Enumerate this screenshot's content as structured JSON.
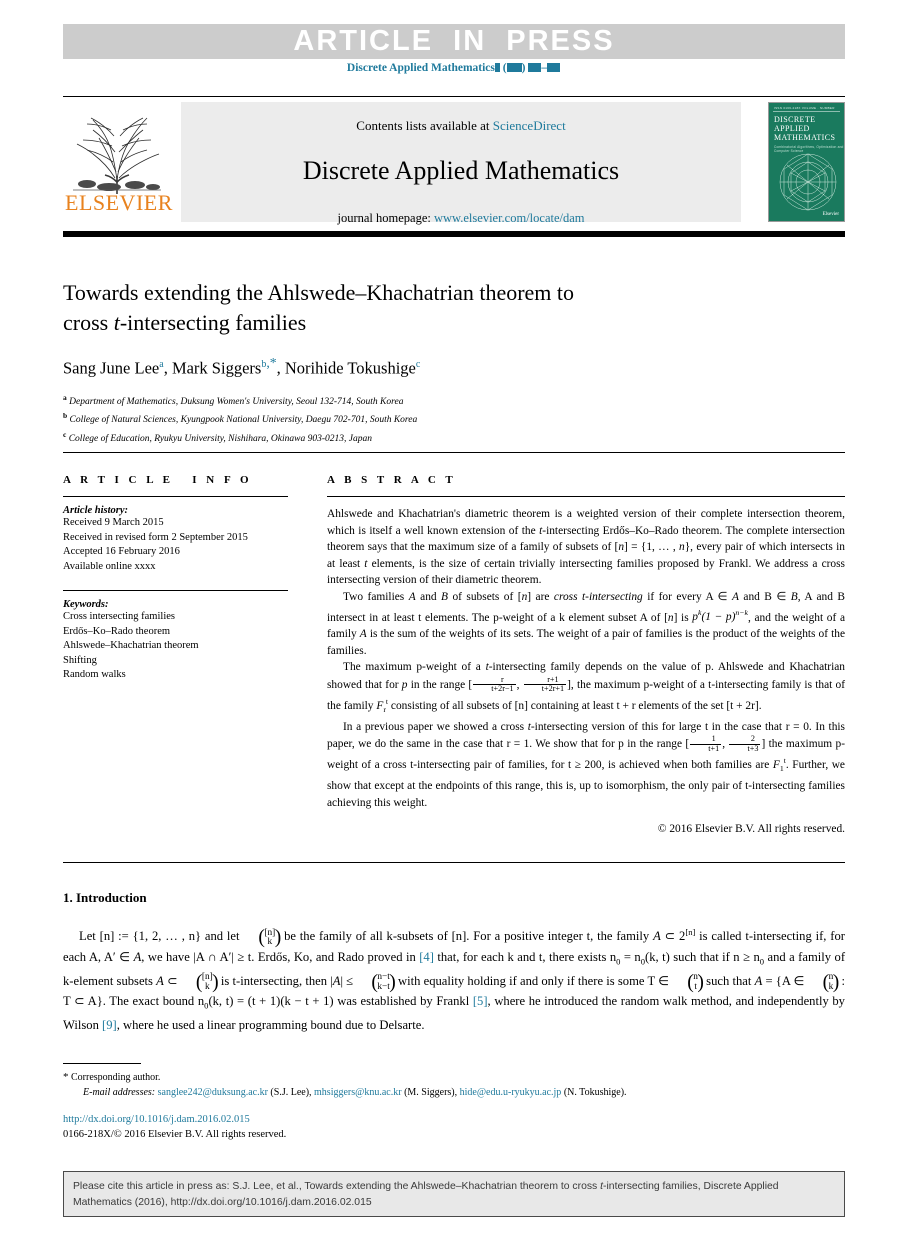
{
  "banner": {
    "article_in_press": "ARTICLE  IN  PRESS",
    "journal_ref_prefix": "Discrete Applied Mathematics"
  },
  "masthead": {
    "contents_prefix": "Contents lists available at ",
    "contents_link": "ScienceDirect",
    "journal_title": "Discrete Applied Mathematics",
    "homepage_prefix": "journal homepage: ",
    "homepage_link": "www.elsevier.com/locate/dam",
    "publisher": "ELSEVIER",
    "cover": {
      "top_strip": "ISSN 0166-218X  VOLUME  ·  NUMBER",
      "title_line1": "DISCRETE",
      "title_line2": "APPLIED",
      "title_line3": "MATHEMATICS",
      "subtitle": "Combinatorial Algorithms, Optimization and Computer Science",
      "footer": "Elsevier"
    }
  },
  "article": {
    "title_line1": "Towards extending the Ahlswede–Khachatrian theorem to",
    "title_line2_pre": "cross ",
    "title_line2_ital": "t",
    "title_line2_post": "-intersecting families",
    "authors": [
      {
        "name": "Sang June Lee",
        "mark": "a",
        "star": false
      },
      {
        "name": "Mark Siggers",
        "mark": "b",
        "star": true
      },
      {
        "name": "Norihide Tokushige",
        "mark": "c",
        "star": false
      }
    ],
    "affiliations": [
      {
        "mark": "a",
        "text": "Department of Mathematics, Duksung Women's University, Seoul 132-714, South Korea"
      },
      {
        "mark": "b",
        "text": "College of Natural Sciences, Kyungpook National University, Daegu 702-701, South Korea"
      },
      {
        "mark": "c",
        "text": "College of Education, Ryukyu University, Nishihara, Okinawa 903-0213, Japan"
      }
    ]
  },
  "info": {
    "heading": "A R T I C L E   I N F O",
    "history_label": "Article history:",
    "history": [
      "Received 9 March 2015",
      "Received in revised form 2 September 2015",
      "Accepted 16 February 2016",
      "Available online xxxx"
    ],
    "keywords_label": "Keywords:",
    "keywords": [
      "Cross intersecting families",
      "Erdős–Ko–Rado theorem",
      "Ahlswede–Khachatrian theorem",
      "Shifting",
      "Random walks"
    ]
  },
  "abstract": {
    "heading": "A B S T R A C T",
    "p1_a": "Ahlswede and Khachatrian's diametric theorem is a weighted version of their complete intersection theorem, which is itself a well known extension of the ",
    "p1_t": "t",
    "p1_b": "-intersecting Erdős–Ko–Rado theorem. The complete intersection theorem says that the maximum size of a family of subsets of [",
    "p1_n1": "n",
    "p1_c": "] = {1, … , ",
    "p1_n2": "n",
    "p1_d": "}, every pair of which intersects in at least ",
    "p1_t2": "t",
    "p1_e": " elements, is the size of certain trivially intersecting families proposed by Frankl. We address a cross intersecting version of their diametric theorem.",
    "p2_a": "Two families ",
    "p2_A": "A",
    "p2_b": " and ",
    "p2_B": "B",
    "p2_c": " of subsets of [",
    "p2_n": "n",
    "p2_d": "] are ",
    "p2_it": "cross t-intersecting",
    "p2_e": " if for every A ∈ ",
    "p2_f": " and B ∈ ",
    "p2_g": ", A and B intersect in at least t elements. The p-weight of a k element subset A of [",
    "p2_h": "] is ",
    "p2_i": ", and the weight of a family ",
    "p2_j": " is the sum of the weights of its sets. The weight of a pair of families is the product of the weights of the families.",
    "p3_a": "The maximum p-weight of a ",
    "p3_t": "t",
    "p3_b": "-intersecting family depends on the value of p. Ahlswede and Khachatrian showed that for ",
    "p3_p": "p",
    "p3_c": " in the range [",
    "p3_frac1_num": "r",
    "p3_frac1_den": "t+2r−1",
    "p3_comma": ", ",
    "p3_frac2_num": "r+1",
    "p3_frac2_den": "t+2r+1",
    "p3_d": "], the maximum p-weight of a t-intersecting family is that of the family ",
    "p3_fam": "F",
    "p3_sub": "r",
    "p3_sup": "t",
    "p3_e": " consisting of all subsets of [n] containing at least t + r elements of the set [t + 2r].",
    "p4_a": "In a previous paper we showed a cross ",
    "p4_t": "t",
    "p4_b": "-intersecting version of this for large t in the case that r = 0. In this paper, we do the same in the case that r = 1. We show that for p in the range [",
    "p4_frac1_num": "1",
    "p4_frac1_den": "t+1",
    "p4_comma": ", ",
    "p4_frac2_num": "2",
    "p4_frac2_den": "t+3",
    "p4_c": "] the maximum p-weight of a cross t-intersecting pair of families, for t ≥ 200, is achieved when both families are ",
    "p4_fam": "F",
    "p4_sub": "1",
    "p4_sup": "t",
    "p4_d": ". Further, we show that except at the endpoints of this range, this is, up to isomorphism, the only pair of t-intersecting families achieving this weight.",
    "copyright": "© 2016 Elsevier B.V. All rights reserved."
  },
  "introduction": {
    "heading": "1. Introduction",
    "p_a": "Let [n] := {1, 2, … , n} and let ",
    "p_binom_n": "[n]",
    "p_binom_k": "k",
    "p_b": " be the family of all k-subsets of [n]. For a positive integer t, the family ",
    "p_A": "A",
    "p_c": " ⊂ 2",
    "p_sup": "[n]",
    "p_d": " is called t-intersecting if, for each A, A′ ∈ ",
    "p_e": ", we have |A ∩ A′| ≥ t. Erdős, Ko, and Rado proved in ",
    "cit1": "[4]",
    "p_f": " that, for each k and t, there exists n",
    "p_g": " = n",
    "p_h": "(k, t) such that if n ≥ n",
    "p_i": " and a family of k-element subsets ",
    "p_j": " ⊂ ",
    "p_k": " is t-intersecting, then |",
    "p_l": "| ≤ ",
    "p_binom2_n": "n−t",
    "p_binom2_k": "k−t",
    "p_m": " with equality holding if and only if there is some T ∈ ",
    "p_binom3_n": "n",
    "p_binom3_k": "t",
    "p_n": " such that ",
    "p_o": " = {A ∈ ",
    "p_binom4_n": "n",
    "p_binom4_k": "k",
    "p_p": " : T ⊂ A}. The exact bound n",
    "p_q": "(k, t) = (t + 1)(k − t + 1) was established by Frankl ",
    "cit2": "[5]",
    "p_r": ", where he introduced the random walk method, and independently by Wilson ",
    "cit3": "[9]",
    "p_s": ", where he used a linear programming bound due to Delsarte."
  },
  "footnotes": {
    "corresponding": "Corresponding author.",
    "email_label": "E-mail addresses:",
    "emails": [
      {
        "address": "sanglee242@duksung.ac.kr",
        "owner": "(S.J. Lee)"
      },
      {
        "address": "mhsiggers@knu.ac.kr",
        "owner": "(M. Siggers)"
      },
      {
        "address": "hide@edu.u-ryukyu.ac.jp",
        "owner": "(N. Tokushige)"
      }
    ],
    "doi": "http://dx.doi.org/10.1016/j.dam.2016.02.015",
    "issn": "0166-218X/© 2016 Elsevier B.V. All rights reserved."
  },
  "cite_box": {
    "line1_a": "Please cite this article in press as: S.J. Lee, et al., Towards extending the Ahlswede–Khachatrian theorem to cross ",
    "line1_t": "t",
    "line1_b": "-intersecting families, Discrete Applied",
    "line2": "Mathematics (2016), http://dx.doi.org/10.1016/j.dam.2016.02.015"
  },
  "colors": {
    "link": "#1f7a9c",
    "banner_bg": "#cccccc",
    "elsevier_orange": "#e8821e",
    "cover_green": "#1a7a5e",
    "box_bg": "#e8e8e8"
  }
}
